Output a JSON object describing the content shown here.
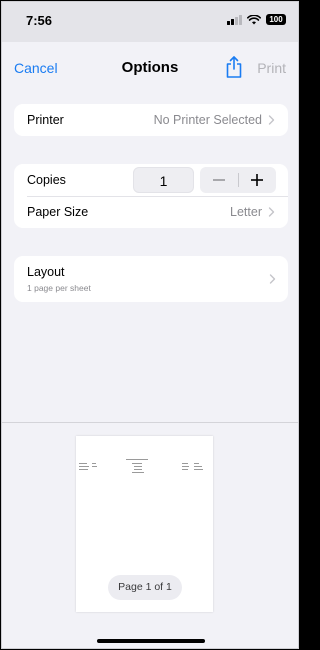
{
  "status_bar": {
    "time": "7:56",
    "battery": "100"
  },
  "nav": {
    "cancel_label": "Cancel",
    "title": "Options",
    "print_label": "Print",
    "share_icon": "share-icon"
  },
  "printer_group": {
    "label": "Printer",
    "value": "No Printer Selected"
  },
  "copies_group": {
    "copies_label": "Copies",
    "copies_value": "1",
    "paper_size_label": "Paper Size",
    "paper_size_value": "Letter"
  },
  "layout_group": {
    "label": "Layout",
    "value": "1 page per sheet"
  },
  "preview": {
    "page_indicator": "Page 1 of 1"
  },
  "colors": {
    "accent": "#1a7cf2",
    "disabled": "#b3b3b8",
    "background": "#f2f2f7",
    "secondary_text": "#8a8a8f"
  }
}
